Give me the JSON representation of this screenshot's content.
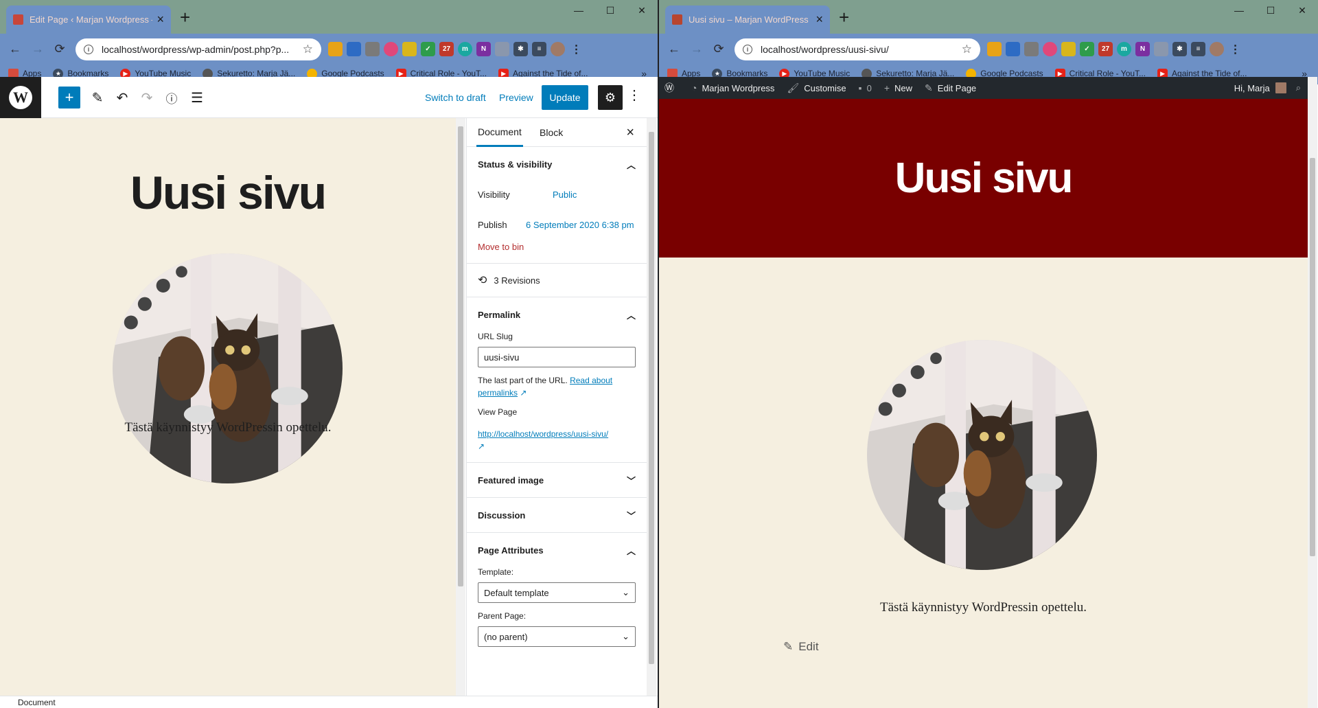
{
  "left_window": {
    "tab_title": "Edit Page ‹ Marjan Wordpress —",
    "url": "localhost/wordpress/wp-admin/post.php?p...",
    "toolbar": {
      "switch_to_draft": "Switch to draft",
      "preview": "Preview",
      "update": "Update"
    },
    "editor": {
      "page_title": "Uusi sivu",
      "paragraph": "Tästä käynnistyy WordPressin opettelu."
    },
    "sidebar": {
      "tab_document": "Document",
      "tab_block": "Block",
      "status_visibility": "Status & visibility",
      "visibility_label": "Visibility",
      "visibility_value": "Public",
      "publish_label": "Publish",
      "publish_value": "6 September 2020 6:38 pm",
      "move_to_bin": "Move to bin",
      "revisions": "3 Revisions",
      "permalink": "Permalink",
      "url_slug_label": "URL Slug",
      "url_slug_value": "uusi-sivu",
      "help_text": "The last part of the URL.",
      "help_link": "Read about permalinks",
      "view_page": "View Page",
      "view_link": "http://localhost/wordpress/uusi-sivu/",
      "featured_image": "Featured image",
      "discussion": "Discussion",
      "page_attributes": "Page Attributes",
      "template_label": "Template:",
      "template_value": "Default template",
      "parent_label": "Parent Page:",
      "parent_value": "(no parent)"
    },
    "status_text": "Document"
  },
  "right_window": {
    "tab_title": "Uusi sivu – Marjan WordPress",
    "url": "localhost/wordpress/uusi-sivu/",
    "adminbar": {
      "site_name": "Marjan Wordpress",
      "customise": "Customise",
      "comments": "0",
      "new": "New",
      "edit_page": "Edit Page",
      "greeting": "Hi, Marja"
    },
    "page": {
      "title": "Uusi sivu",
      "paragraph": "Tästä käynnistyy WordPressin opettelu.",
      "edit": "Edit"
    }
  },
  "bookmarks": [
    "Apps",
    "Bookmarks",
    "YouTube Music",
    "Sekuretto: Marja Jä...",
    "Google Podcasts",
    "Critical Role - YouT...",
    "Against the Tide of..."
  ],
  "colors": {
    "wp_blue": "#007cba",
    "hero_red": "#790000",
    "page_bg": "#f5efe0",
    "chrome_tabstrip": "#7f9f8f",
    "chrome_toolbar": "#6d90c5"
  }
}
